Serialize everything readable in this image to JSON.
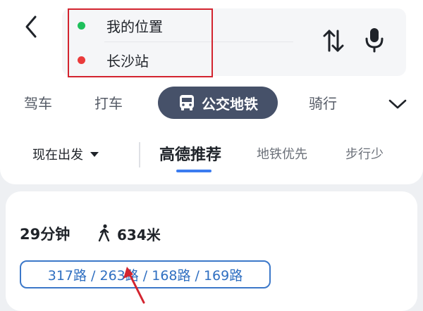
{
  "header": {
    "origin": "我的位置",
    "destination": "长沙站"
  },
  "icons": {
    "back": "chevron-left-icon",
    "swap": "swap-vertical-icon",
    "mic": "microphone-icon",
    "bus": "bus-icon",
    "expand": "chevron-down-icon",
    "walk": "walking-person-icon"
  },
  "modes": {
    "drive": "驾车",
    "taxi": "打车",
    "transit": "公交地铁",
    "ride": "骑行",
    "selected": "transit"
  },
  "filters": {
    "depart": "现在出发",
    "recommended": "高德推荐",
    "metro_first": "地铁优先",
    "less_walking": "步行少"
  },
  "route": {
    "duration": "29分钟",
    "walk_distance": "634米",
    "lines": "317路 / 263路 / 168路 / 169路"
  },
  "colors": {
    "accent_blue": "#3b7cf0",
    "transit_pill": "#465169",
    "highlight_red": "#d3242f",
    "origin_dot": "#1fc05c",
    "destination_dot": "#ea3b3b",
    "line_text": "#2f6fc1"
  }
}
